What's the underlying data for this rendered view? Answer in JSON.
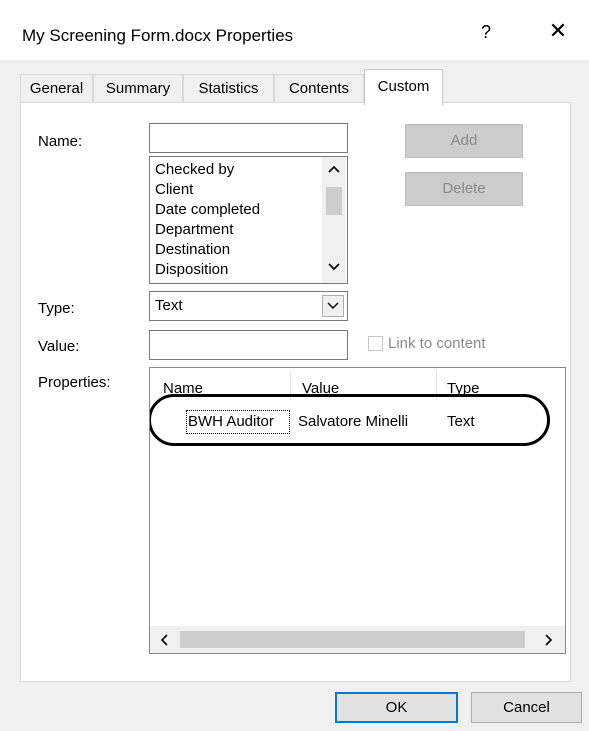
{
  "window": {
    "title": "My Screening Form.docx Properties",
    "help_label": "?",
    "close_label": "✕"
  },
  "tabs": [
    {
      "label": "General"
    },
    {
      "label": "Summary"
    },
    {
      "label": "Statistics"
    },
    {
      "label": "Contents"
    },
    {
      "label": "Custom",
      "active": true
    }
  ],
  "form": {
    "name_label": "Name:",
    "name_value": "",
    "name_options": [
      "Checked by",
      "Client",
      "Date completed",
      "Department",
      "Destination",
      "Disposition"
    ],
    "add_label": "Add",
    "delete_label": "Delete",
    "type_label": "Type:",
    "type_value": "Text",
    "value_label": "Value:",
    "value_value": "",
    "link_label": "Link to content",
    "link_checked": false,
    "properties_label": "Properties:"
  },
  "properties_table": {
    "columns": [
      "Name",
      "Value",
      "Type"
    ],
    "rows": [
      {
        "name": "BWH Auditor",
        "value": "Salvatore Minelli",
        "type": "Text"
      }
    ]
  },
  "footer": {
    "ok_label": "OK",
    "cancel_label": "Cancel"
  },
  "icons": {
    "scroll_up": "chevron-up-icon",
    "scroll_down": "chevron-down-icon",
    "scroll_left": "chevron-left-icon",
    "scroll_right": "chevron-right-icon",
    "dropdown": "chevron-down-icon"
  },
  "colors": {
    "default_button_border": "#0078d7",
    "disabled_button_bg": "#cccccc",
    "dialog_bg": "#f0f0f0"
  }
}
